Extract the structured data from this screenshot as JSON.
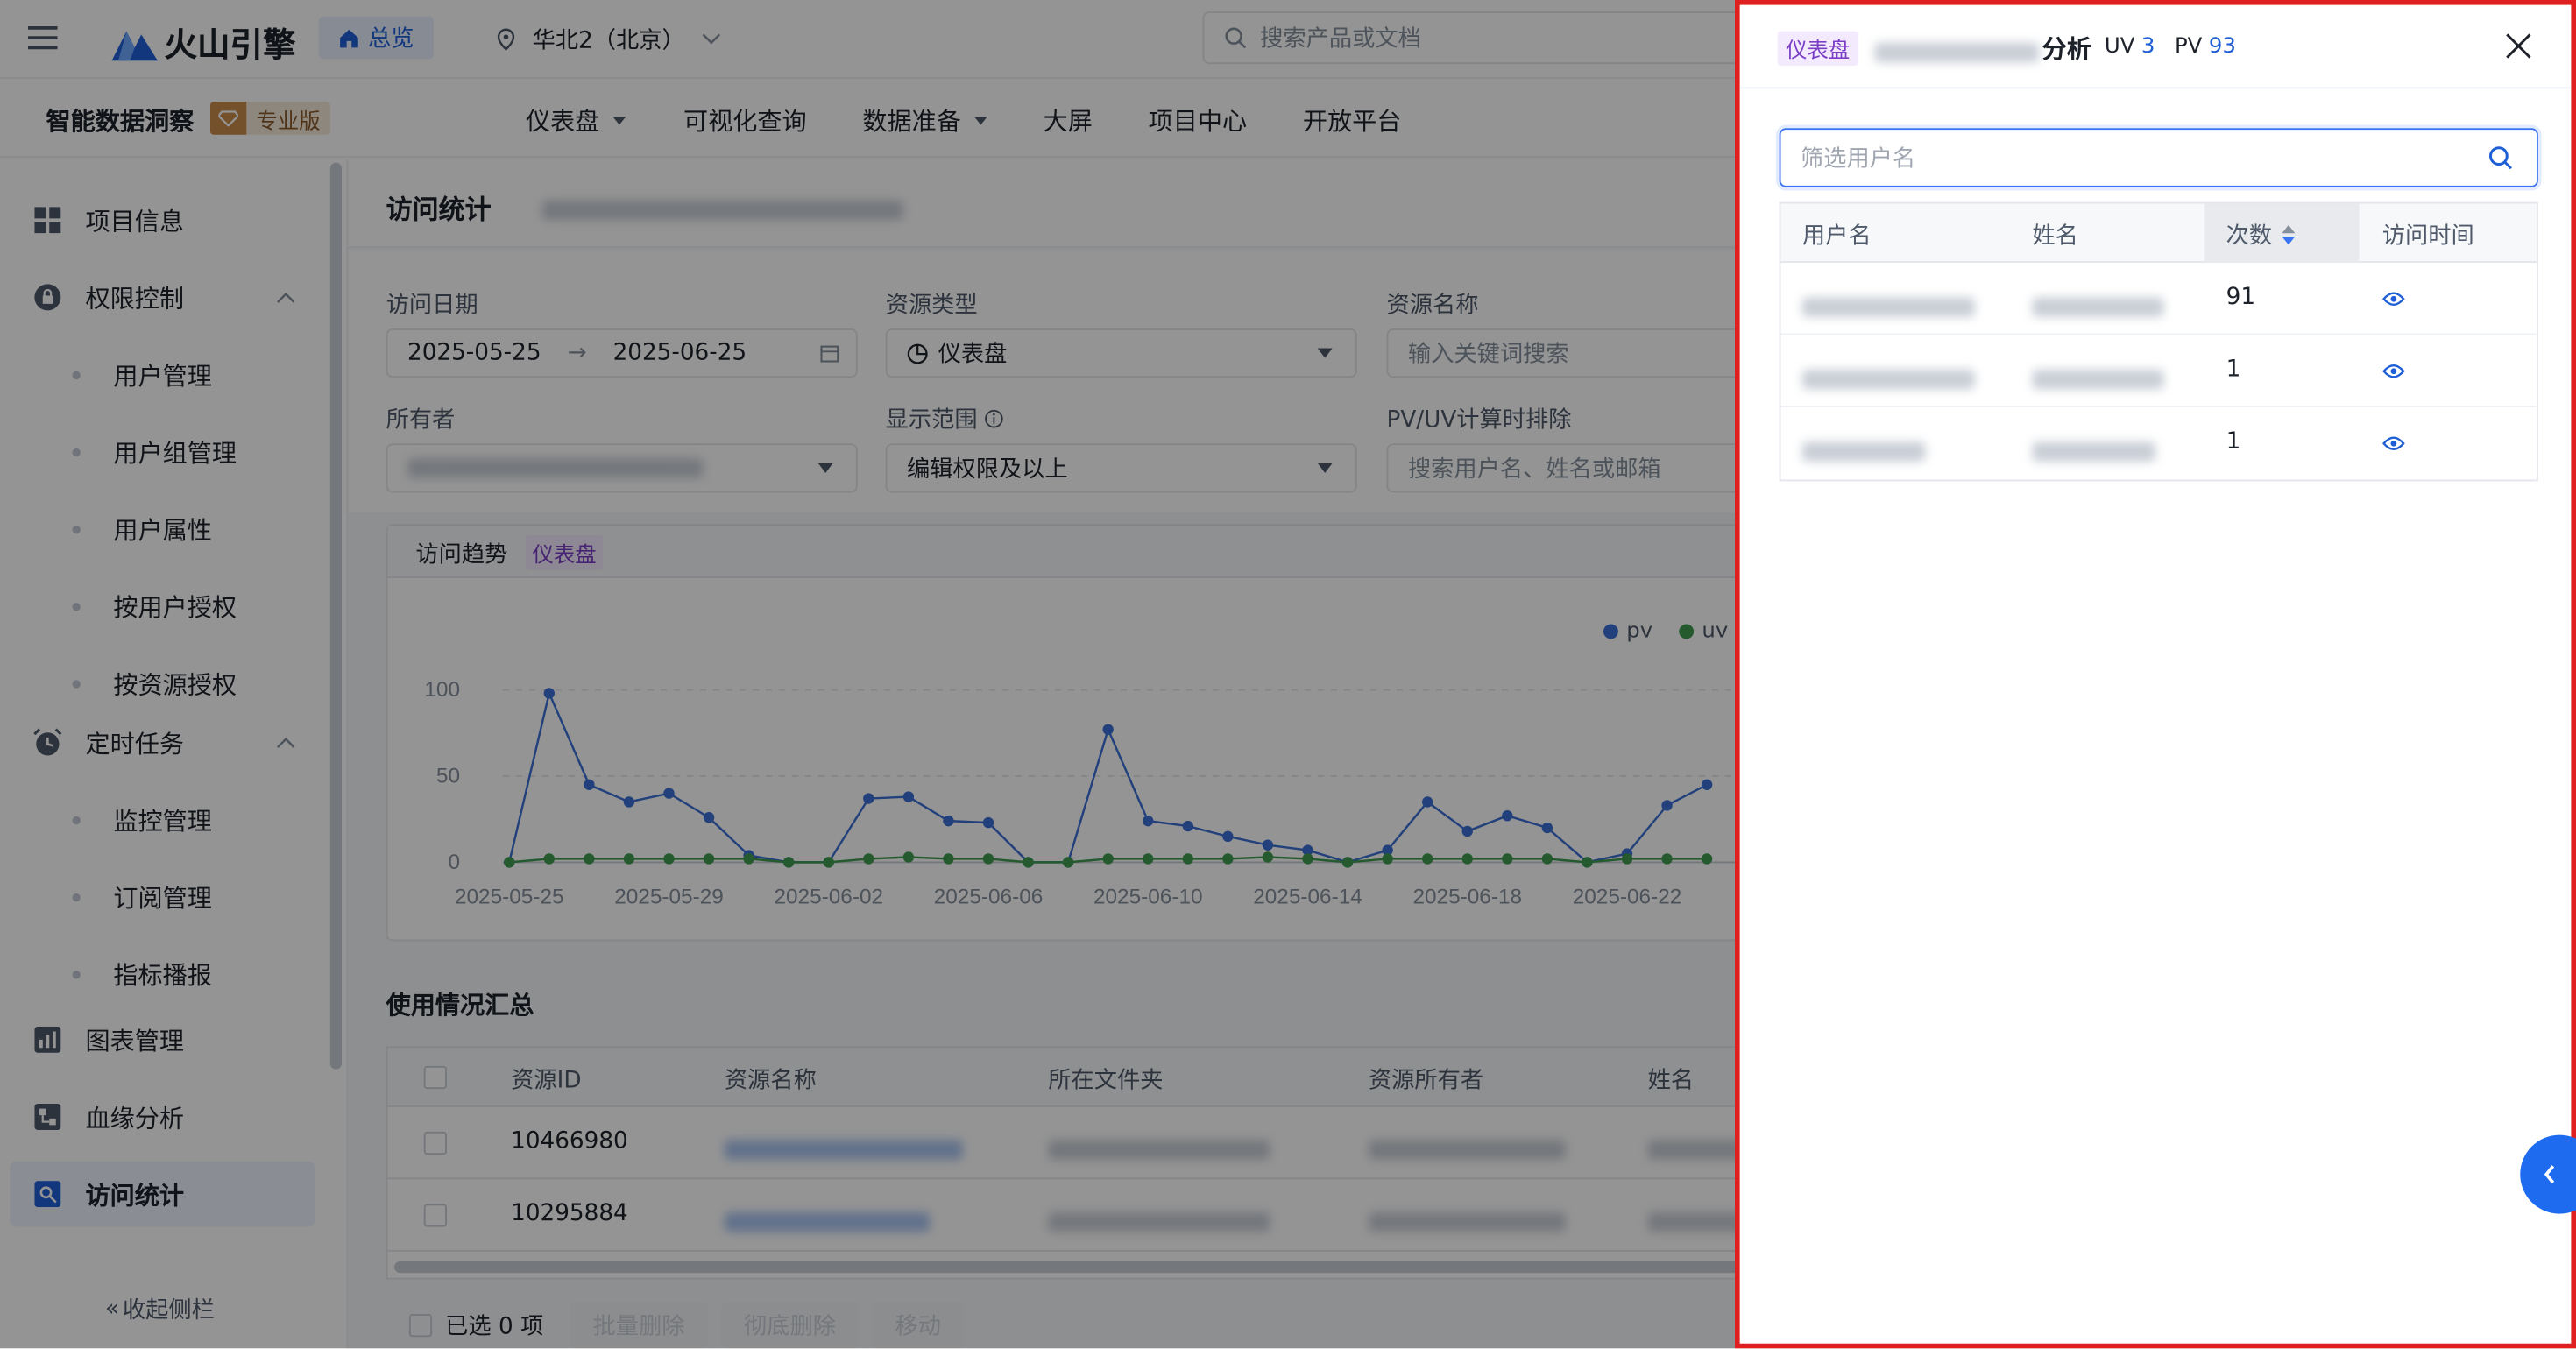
{
  "topbar": {
    "logo_text": "火山引擎",
    "overview": "总览",
    "region": "华北2（北京）",
    "search_placeholder": "搜索产品或文档"
  },
  "subnav": {
    "product": "智能数据洞察",
    "edition": "专业版",
    "items": [
      "仪表盘",
      "可视化查询",
      "数据准备",
      "大屏",
      "项目中心",
      "开放平台"
    ]
  },
  "sidebar": {
    "items": [
      {
        "label": "项目信息"
      },
      {
        "label": "权限控制"
      },
      {
        "label": "用户管理"
      },
      {
        "label": "用户组管理"
      },
      {
        "label": "用户属性"
      },
      {
        "label": "按用户授权"
      },
      {
        "label": "按资源授权"
      },
      {
        "label": "定时任务"
      },
      {
        "label": "监控管理"
      },
      {
        "label": "订阅管理"
      },
      {
        "label": "指标播报"
      },
      {
        "label": "图表管理"
      },
      {
        "label": "血缘分析"
      },
      {
        "label": "访问统计"
      }
    ],
    "collapse": "收起侧栏"
  },
  "main": {
    "title": "访问统计",
    "filters": {
      "date_label": "访问日期",
      "date_start": "2025-05-25",
      "date_end": "2025-06-25",
      "type_label": "资源类型",
      "type_value": "仪表盘",
      "name_label": "资源名称",
      "name_placeholder": "输入关键词搜索",
      "owner_label": "所有者",
      "scope_label": "显示范围",
      "scope_value": "编辑权限及以上",
      "exclude_label": "PV/UV计算时排除",
      "exclude_placeholder": "搜索用户名、姓名或邮箱"
    },
    "trend_title": "访问趋势",
    "trend_tag": "仪表盘",
    "summary_title": "使用情况汇总",
    "table": {
      "headers": [
        "资源ID",
        "资源名称",
        "所在文件夹",
        "资源所有者",
        "姓名"
      ],
      "rows": [
        {
          "id": "10466980"
        },
        {
          "id": "10295884"
        }
      ]
    },
    "footer": {
      "selected": "已选 0 项",
      "batch_delete": "批量删除",
      "delete_forever": "彻底删除",
      "move": "移动"
    }
  },
  "chart_data": {
    "type": "line",
    "x": [
      "2025-05-25",
      "2025-05-26",
      "2025-05-27",
      "2025-05-28",
      "2025-05-29",
      "2025-05-30",
      "2025-05-31",
      "2025-06-01",
      "2025-06-02",
      "2025-06-03",
      "2025-06-04",
      "2025-06-05",
      "2025-06-06",
      "2025-06-07",
      "2025-06-08",
      "2025-06-09",
      "2025-06-10",
      "2025-06-11",
      "2025-06-12",
      "2025-06-13",
      "2025-06-14",
      "2025-06-15",
      "2025-06-16",
      "2025-06-17",
      "2025-06-18",
      "2025-06-19",
      "2025-06-20",
      "2025-06-21",
      "2025-06-22",
      "2025-06-23",
      "2025-06-24"
    ],
    "xticks": [
      "2025-05-25",
      "2025-05-29",
      "2025-06-02",
      "2025-06-06",
      "2025-06-10",
      "2025-06-14",
      "2025-06-18",
      "2025-06-22"
    ],
    "yticks": [
      0,
      50,
      100
    ],
    "ylim": [
      0,
      100
    ],
    "series": [
      {
        "name": "pv",
        "color": "#3b6fd4",
        "values": [
          0,
          98,
          45,
          35,
          40,
          26,
          4,
          0,
          0,
          37,
          38,
          24,
          23,
          0,
          0,
          77,
          24,
          21,
          15,
          10,
          7,
          0,
          7,
          35,
          18,
          27,
          20,
          0,
          5,
          33,
          45
        ]
      },
      {
        "name": "uv",
        "color": "#3e9b4f",
        "values": [
          0,
          2,
          2,
          2,
          2,
          2,
          2,
          0,
          0,
          2,
          3,
          2,
          2,
          0,
          0,
          2,
          2,
          2,
          2,
          3,
          2,
          0,
          2,
          2,
          2,
          2,
          2,
          0,
          2,
          2,
          2
        ]
      }
    ],
    "legend": "top-right"
  },
  "drawer": {
    "tag": "仪表盘",
    "title_suffix": "分析",
    "uv_label": "UV",
    "uv_value": "3",
    "pv_label": "PV",
    "pv_value": "93",
    "search_placeholder": "筛选用户名",
    "headers": [
      "用户名",
      "姓名",
      "次数",
      "访问时间"
    ],
    "rows": [
      {
        "count": "91"
      },
      {
        "count": "1"
      },
      {
        "count": "1"
      }
    ]
  }
}
